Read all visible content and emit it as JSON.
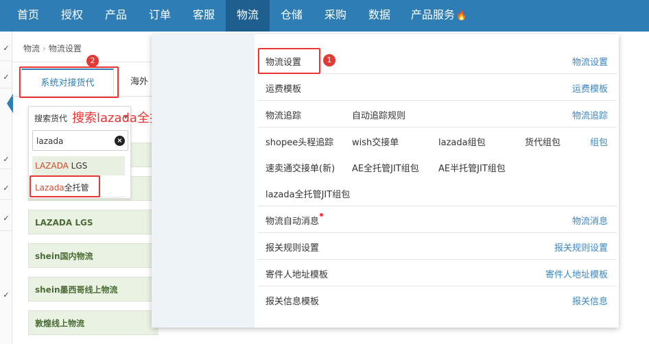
{
  "nav": {
    "items": [
      "首页",
      "授权",
      "产品",
      "订单",
      "客服",
      "物流",
      "仓储",
      "采购",
      "数据",
      "产品服务"
    ],
    "active": "物流",
    "fire_icon": "fire-icon"
  },
  "breadcrumb": {
    "root": "物流",
    "current": "物流设置"
  },
  "tabs": {
    "active": "系统对接货代",
    "other": "海外"
  },
  "search_popup": {
    "title": "搜索货代",
    "input_value": "lazada",
    "options": [
      {
        "match": "LAZADA",
        "rest": " LGS"
      },
      {
        "match": "Lazada",
        "rest": "全托管"
      }
    ]
  },
  "annotation": {
    "text": "搜索lazada全托管",
    "badge1": "1",
    "badge2": "2",
    "color": "#e33333"
  },
  "carriers": [
    "",
    "",
    "LAZADA LGS",
    "shein国内物流",
    "shein墨西哥线上物流",
    "敦煌线上物流"
  ],
  "mega": {
    "categories": [
      "物流设置",
      "运费模板",
      "物流追踪",
      "组包",
      "物流消息",
      "报关规则设置",
      "寄件人地址模板",
      "报关信息"
    ],
    "row_wuliushezhi": [
      "物流设置"
    ],
    "row_yunfei": [
      "运费模板"
    ],
    "row_zhuizong": [
      "物流追踪",
      "自动追踪规则"
    ],
    "row_zubao_1": [
      "shopee头程追踪",
      "wish交接单",
      "lazada组包",
      "货代组包"
    ],
    "row_zubao_2": [
      "速卖通交接单(新)",
      "AE全托管JIT组包",
      "AE半托管JIT组包"
    ],
    "row_zubao_3": [
      "lazada全托管JIT组包"
    ],
    "row_xiaoxi": [
      "物流自动消息"
    ],
    "row_baoguan_rule": [
      "报关规则设置"
    ],
    "row_jijian": [
      "寄件人地址模板"
    ],
    "row_baoguan_info": [
      "报关信息模板"
    ]
  },
  "colors": {
    "nav_bg": "#2e7db5",
    "nav_active": "#1f5f90",
    "category_text": "#3a86c4",
    "carrier_bg": "#eaf2e4"
  }
}
